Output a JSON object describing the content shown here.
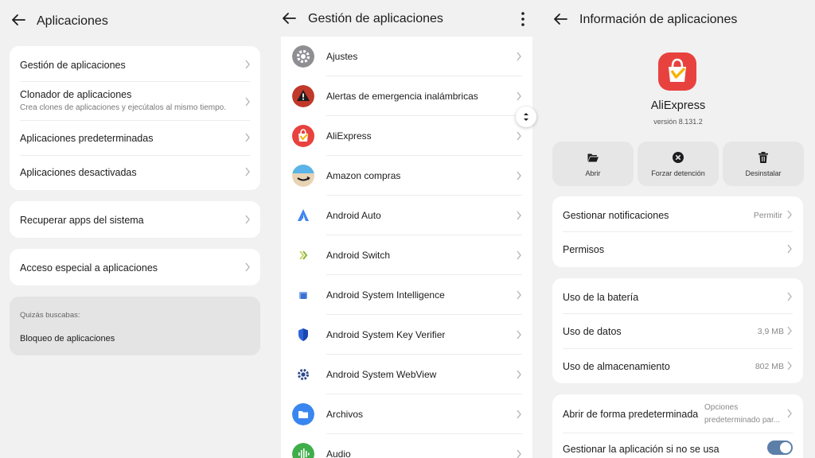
{
  "panel1": {
    "title": "Aplicaciones",
    "group1": [
      {
        "label": "Gestión de aplicaciones"
      },
      {
        "label": "Clonador de aplicaciones",
        "sub": "Crea clones de aplicaciones y ejecútalos al mismo tiempo."
      },
      {
        "label": "Aplicaciones predeterminadas"
      },
      {
        "label": "Aplicaciones desactivadas"
      }
    ],
    "recover": "Recuperar apps del sistema",
    "special": "Acceso especial a aplicaciones",
    "suggest_header": "Quizás buscabas:",
    "suggest_item": "Bloqueo de aplicaciones"
  },
  "panel2": {
    "title": "Gestión de aplicaciones",
    "apps": [
      {
        "name": "Ajustes",
        "icon": "gear-icon"
      },
      {
        "name": "Alertas de emergencia inalámbricas",
        "icon": "warning-icon"
      },
      {
        "name": "AliExpress",
        "icon": "aliexpress-icon"
      },
      {
        "name": "Amazon compras",
        "icon": "amazon-icon"
      },
      {
        "name": "Android Auto",
        "icon": "android-auto-icon"
      },
      {
        "name": "Android Switch",
        "icon": "android-switch-icon"
      },
      {
        "name": "Android System Intelligence",
        "icon": "system-intelligence-icon"
      },
      {
        "name": "Android System Key Verifier",
        "icon": "shield-icon"
      },
      {
        "name": "Android System WebView",
        "icon": "webview-gear-icon"
      },
      {
        "name": "Archivos",
        "icon": "folder-icon"
      },
      {
        "name": "Audio",
        "icon": "audio-icon"
      }
    ]
  },
  "panel3": {
    "title": "Información de aplicaciones",
    "app_name": "AliExpress",
    "version": "versión 8.131.2",
    "actions": [
      {
        "label": "Abrir",
        "icon": "folder-open-icon"
      },
      {
        "label": "Forzar detención",
        "icon": "close-circle-icon"
      },
      {
        "label": "Desinstalar",
        "icon": "trash-icon"
      }
    ],
    "notifications": {
      "label": "Gestionar notificaciones",
      "value": "Permitir"
    },
    "permissions": {
      "label": "Permisos"
    },
    "battery": {
      "label": "Uso de la batería"
    },
    "data": {
      "label": "Uso de datos",
      "value": "3,9 MB"
    },
    "storage": {
      "label": "Uso de almacenamiento",
      "value": "802 MB"
    },
    "open_default": {
      "label": "Abrir de forma predeterminada",
      "value_line1": "Opciones",
      "value_line2": "predeterminado par..."
    },
    "manage_unused": {
      "label": "Gestionar la aplicación si no se usa",
      "toggle_on": true
    }
  },
  "colors": {
    "accent": "#5b7fa8",
    "background": "#f1f1f1",
    "card": "#ffffff",
    "aliexpress": "#e8423f"
  }
}
